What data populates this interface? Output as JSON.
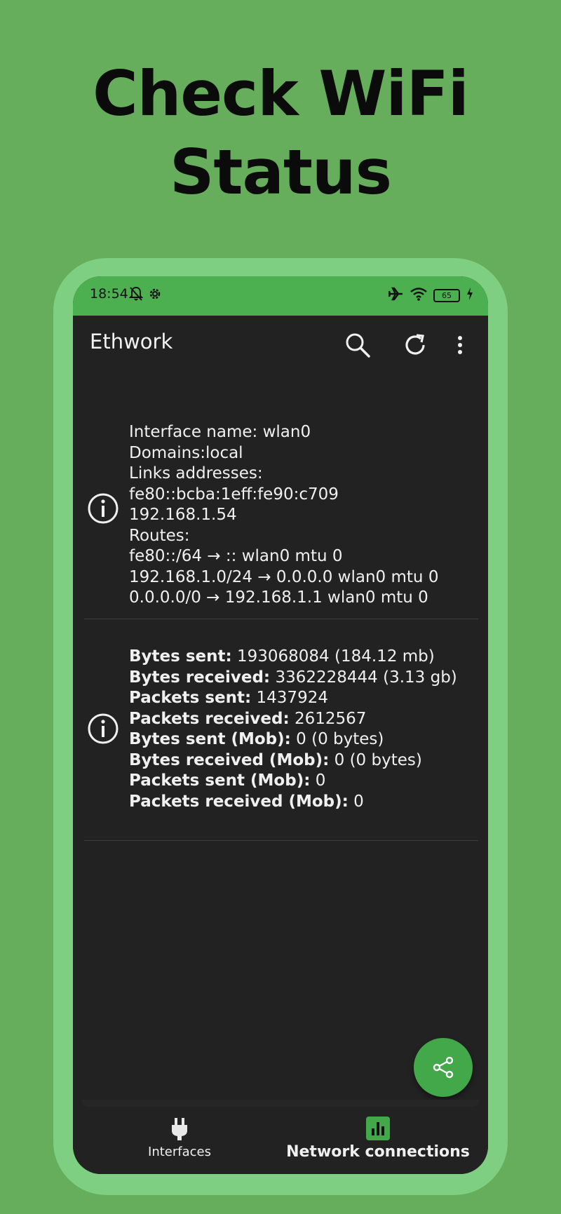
{
  "headline": {
    "line1": "Check WiFi",
    "line2": "Status"
  },
  "status_bar": {
    "time": "18:54",
    "battery": "65"
  },
  "app_bar": {
    "title": "Ethwork"
  },
  "interface_card": {
    "lines": [
      "Interface name: wlan0",
      "Domains:local",
      "Links addresses:",
      "fe80::bcba:1eff:fe90:c709",
      "192.168.1.54",
      "Routes:",
      "fe80::/64 → :: wlan0 mtu 0",
      "192.168.1.0/24 → 0.0.0.0 wlan0 mtu 0",
      "0.0.0.0/0 → 192.168.1.1 wlan0 mtu 0"
    ]
  },
  "stats_card": {
    "rows": [
      {
        "label": "Bytes sent:",
        "value": "193068084 (184.12 mb)"
      },
      {
        "label": "Bytes received:",
        "value": "3362228444 (3.13 gb)"
      },
      {
        "label": "Packets sent:",
        "value": "1437924"
      },
      {
        "label": "Packets received:",
        "value": "2612567"
      },
      {
        "label": "Bytes sent (Mob):",
        "value": "0 (0 bytes)"
      },
      {
        "label": "Bytes received (Mob):",
        "value": "0 (0 bytes)"
      },
      {
        "label": "Packets sent (Mob):",
        "value": "0"
      },
      {
        "label": "Packets received (Mob):",
        "value": "0"
      }
    ]
  },
  "bottom_nav": {
    "interfaces": "Interfaces",
    "network_connections": "Network connections"
  },
  "colors": {
    "background": "#66ad5c",
    "accent": "#4caf50",
    "fab": "#43a84a",
    "screen": "#222222"
  }
}
